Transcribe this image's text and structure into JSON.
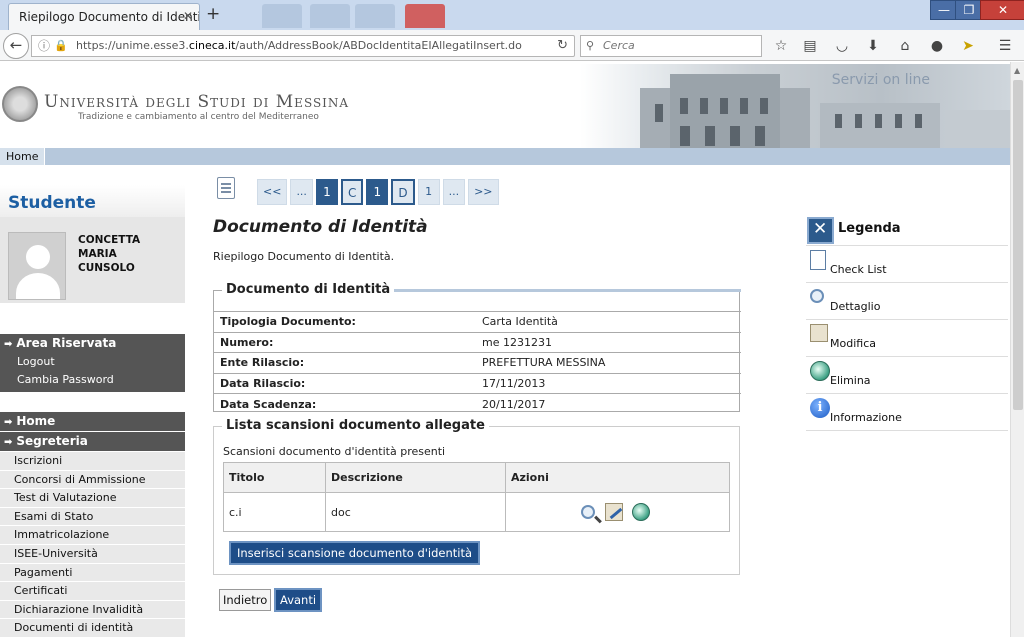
{
  "browser": {
    "tab_title": "Riepilogo Documento di Identi...",
    "tab_close": "✕",
    "new_tab": "+",
    "url_prefix": "https://unime.esse3.",
    "url_domain": "cineca.it",
    "url_suffix": "/auth/AddressBook/ABDocIdentitaEIAllegatiInsert.do",
    "search_placeholder": "Cerca",
    "window_min": "—",
    "window_max": "❐",
    "window_close": "✕"
  },
  "header": {
    "university_name": "Università degli Studi di Messina",
    "tagline": "Tradizione e cambiamento al centro del Mediterraneo",
    "servizi": "Servizi on line"
  },
  "topnav": {
    "home": "Home"
  },
  "sidebar": {
    "title": "Studente",
    "student_name_line1": "CONCETTA MARIA",
    "student_name_line2": "CUNSOLO",
    "area_riservata": {
      "label": "Area Riservata",
      "items": [
        "Logout",
        "Cambia Password"
      ]
    },
    "home": "Home",
    "segreteria": {
      "label": "Segreteria",
      "items": [
        "Iscrizioni",
        "Concorsi di Ammissione",
        "Test di Valutazione",
        "Esami di Stato",
        "Immatricolazione",
        "ISEE-Università",
        "Pagamenti",
        "Certificati",
        "Dichiarazione Invalidità",
        "Documenti di identità"
      ]
    }
  },
  "pager": [
    "<<",
    "...",
    "1",
    "C",
    "1",
    "D",
    "1",
    "...",
    ">>"
  ],
  "main": {
    "title": "Documento di Identità",
    "description": "Riepilogo Documento di Identità.",
    "doc_section": {
      "legend": "Documento di Identità",
      "rows": [
        {
          "key": "Tipologia Documento:",
          "value": "Carta Identità"
        },
        {
          "key": "Numero:",
          "value": "me 1231231"
        },
        {
          "key": "Ente Rilascio:",
          "value": "PREFETTURA MESSINA"
        },
        {
          "key": "Data Rilascio:",
          "value": "17/11/2013"
        },
        {
          "key": "Data Scadenza:",
          "value": "20/11/2017"
        }
      ]
    },
    "scan_section": {
      "legend": "Lista scansioni documento allegate",
      "subtitle": "Scansioni documento d'identità presenti",
      "columns": [
        "Titolo",
        "Descrizione",
        "Azioni"
      ],
      "rows": [
        {
          "titolo": "c.i",
          "descrizione": "doc"
        }
      ],
      "insert_button": "Inserisci scansione documento d'identità"
    },
    "back_button": "Indietro",
    "next_button": "Avanti"
  },
  "legenda": {
    "title": "Legenda",
    "items": [
      "Check List",
      "Dettaglio",
      "Modifica",
      "Elimina",
      "Informazione"
    ]
  },
  "colors": {
    "accent_dark": "#1e4d88",
    "sidebar_dark": "#555555",
    "header_bar": "#b6c8dc",
    "title_blue": "#1d5fa3"
  }
}
